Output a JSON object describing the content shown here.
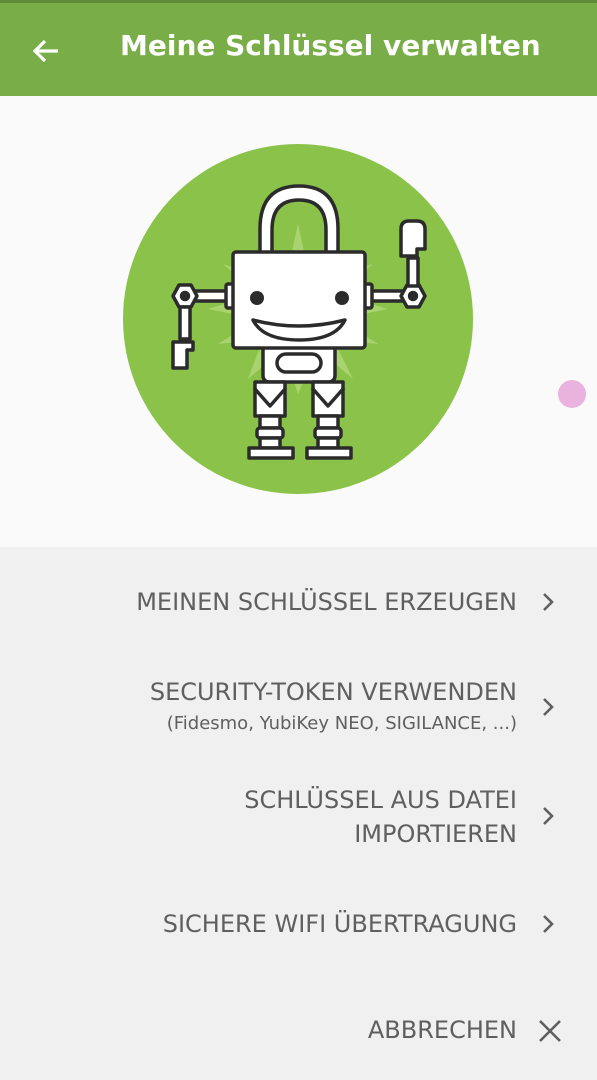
{
  "appbar": {
    "title": "Meine Schlüssel verwalten",
    "back_icon": "arrow-left-icon",
    "color": "#79ad47"
  },
  "hero": {
    "illustration": "padlock-robot-illustration",
    "circle_color": "#8bc34a"
  },
  "menu": {
    "items": [
      {
        "label": "MEINEN SCHLÜSSEL ERZEUGEN",
        "icon": "chevron-right-icon"
      },
      {
        "label": "SECURITY-TOKEN VERWENDEN",
        "sublabel": "(Fidesmo, YubiKey NEO, SIGILANCE, ...)",
        "icon": "chevron-right-icon"
      },
      {
        "label_line1": "SCHLÜSSEL AUS DATEI",
        "label_line2": "IMPORTIEREN",
        "icon": "chevron-right-icon"
      },
      {
        "label": "SICHERE WIFI ÜBERTRAGUNG",
        "icon": "chevron-right-icon"
      }
    ],
    "cancel": {
      "label": "ABBRECHEN",
      "icon": "close-icon"
    }
  }
}
